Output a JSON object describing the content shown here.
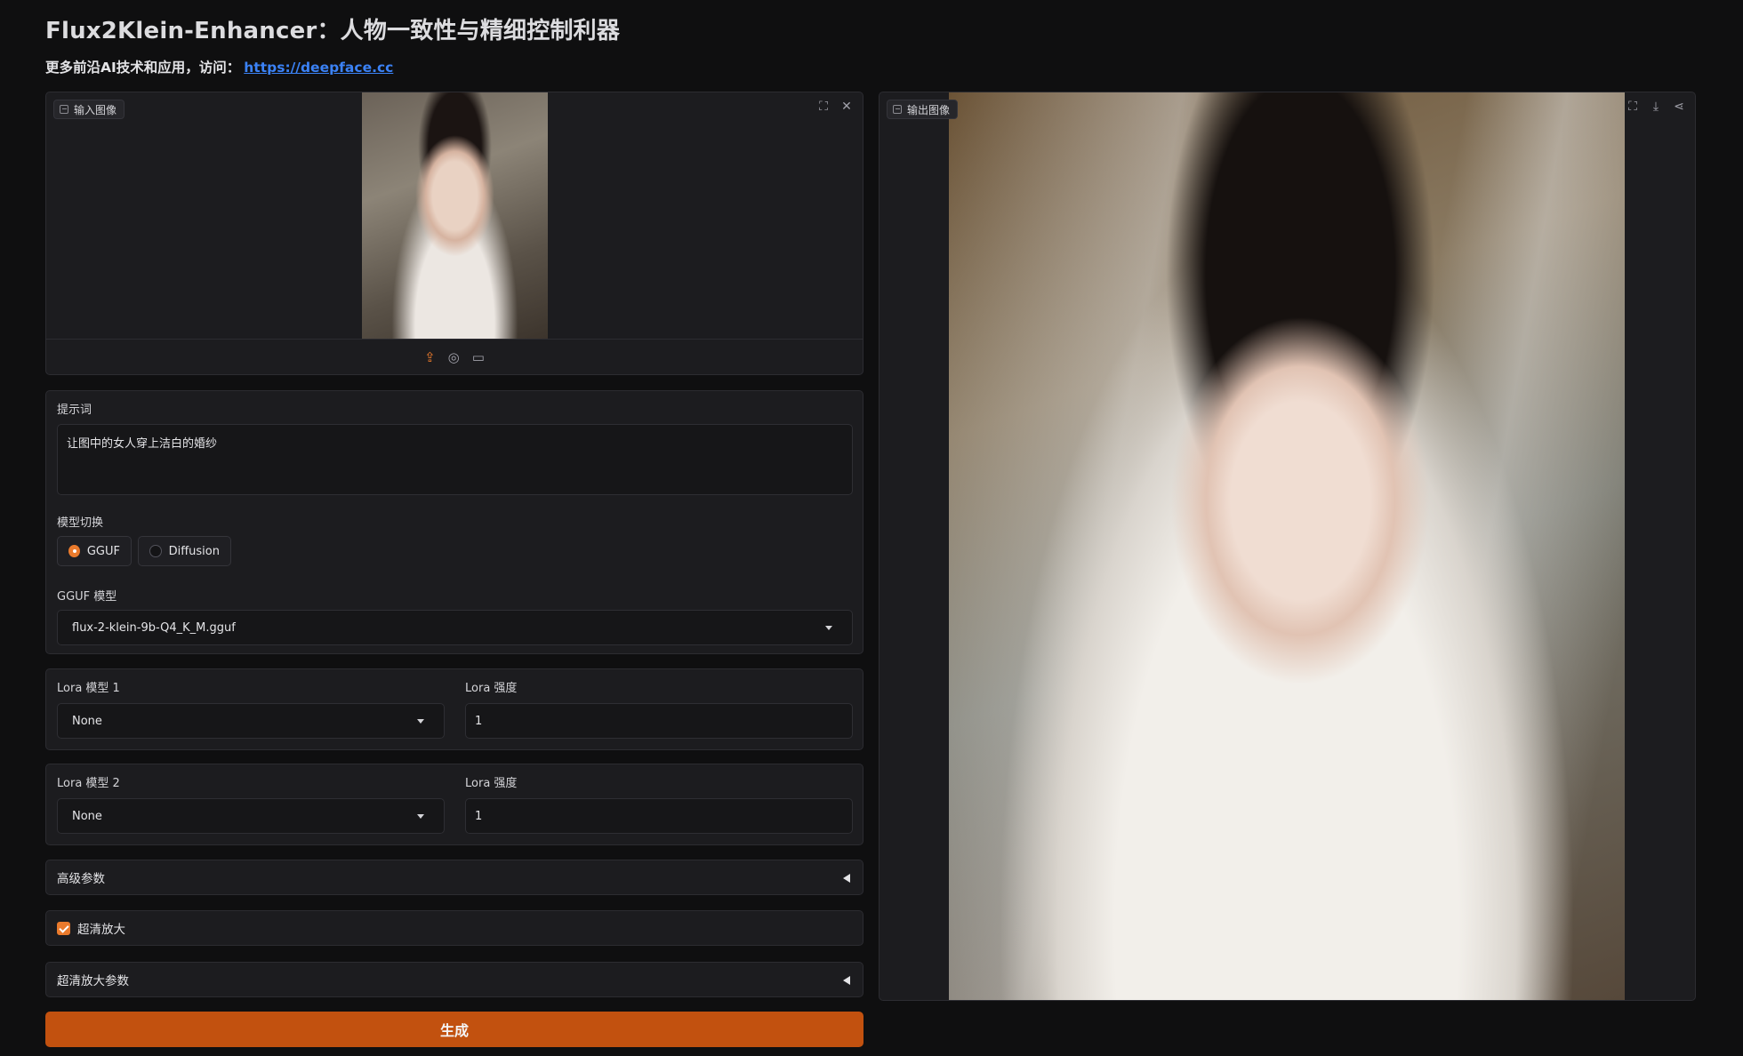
{
  "header": {
    "title": "Flux2Klein-Enhancer：人物一致性与精细控制利器",
    "subtitle_prefix": "更多前沿AI技术和应用，访问：",
    "subtitle_link": "https://deepface.cc"
  },
  "input_image": {
    "label": "输入图像",
    "icons": [
      "fullscreen-icon",
      "close-icon"
    ],
    "source_icons": [
      "upload-icon",
      "webcam-icon",
      "clipboard-icon"
    ]
  },
  "output_image": {
    "label": "输出图像",
    "icons": [
      "fullscreen-icon",
      "download-icon",
      "share-icon"
    ]
  },
  "prompt": {
    "label": "提示词",
    "value": "让图中的女人穿上洁白的婚纱"
  },
  "model_switch": {
    "label": "模型切换",
    "options": [
      "GGUF",
      "Diffusion"
    ],
    "selected": "GGUF"
  },
  "gguf_model": {
    "label": "GGUF 模型",
    "value": "flux-2-klein-9b-Q4_K_M.gguf"
  },
  "lora1": {
    "model_label": "Lora 模型 1",
    "model_value": "None",
    "strength_label": "Lora 强度",
    "strength_value": "1"
  },
  "lora2": {
    "model_label": "Lora 模型 2",
    "model_value": "None",
    "strength_label": "Lora 强度",
    "strength_value": "1"
  },
  "advanced": {
    "label": "高级参数"
  },
  "upscale": {
    "label": "超清放大",
    "checked": true
  },
  "upscale_params": {
    "label": "超清放大参数"
  },
  "generate_button": {
    "label": "生成"
  },
  "colors": {
    "accent": "#ea7a2c",
    "button": "#c2510f",
    "link": "#3b82f6",
    "background": "#0f0f10"
  }
}
